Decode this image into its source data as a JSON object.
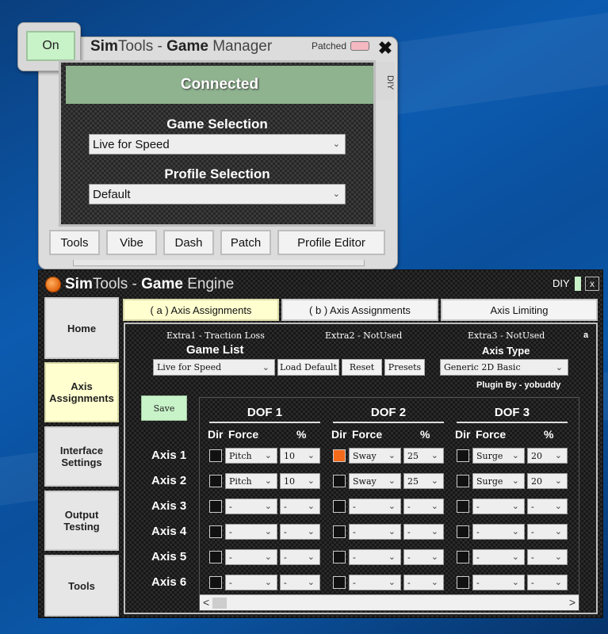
{
  "manager": {
    "on_label": "On",
    "title_sim": "Sim",
    "title_tools": "Tools - ",
    "title_game": "Game",
    "title_manager": " Manager",
    "patched_label": "Patched",
    "close_label": "✖",
    "diy_label": "DIY",
    "status": "Connected",
    "game_selection_label": "Game Selection",
    "game_selection_value": "Live for Speed",
    "profile_selection_label": "Profile Selection",
    "profile_selection_value": "Default",
    "buttons": [
      "Tools",
      "Vibe",
      "Dash",
      "Patch",
      "Profile Editor"
    ]
  },
  "engine": {
    "title_sim": "Sim",
    "title_tools": "Tools - ",
    "title_game": "Game",
    "title_engine": " Engine",
    "diy_label": "DIY",
    "close_label": "x",
    "sidebar": [
      "Home",
      "Axis Assignments",
      "Interface Settings",
      "Output Testing",
      "Tools"
    ],
    "tabs": [
      "( a ) Axis Assignments",
      "( b ) Axis Assignments",
      "Axis Limiting"
    ],
    "extras": [
      "Extra1 - Traction Loss",
      "Extra2 - NotUsed",
      "Extra3 - NotUsed"
    ],
    "extra_marker": "a",
    "game_list_label": "Game List",
    "game_list_value": "Live for Speed",
    "load_default": "Load Default",
    "reset": "Reset",
    "presets": "Presets",
    "axis_type_label": "Axis Type",
    "axis_type_value": "Generic 2D Basic",
    "plugin_by": "Plugin By - yobuddy",
    "save": "Save",
    "dof_headers": [
      "DOF 1",
      "DOF 2",
      "DOF 3"
    ],
    "col_dir": "Dir",
    "col_force": "Force",
    "col_pct": "%",
    "axes": [
      {
        "label": "Axis 1",
        "dof": [
          {
            "dir": false,
            "force": "Pitch",
            "pct": "10"
          },
          {
            "dir": true,
            "force": "Sway",
            "pct": "25"
          },
          {
            "dir": false,
            "force": "Surge",
            "pct": "20"
          }
        ]
      },
      {
        "label": "Axis 2",
        "dof": [
          {
            "dir": false,
            "force": "Pitch",
            "pct": "10"
          },
          {
            "dir": false,
            "force": "Sway",
            "pct": "25"
          },
          {
            "dir": false,
            "force": "Surge",
            "pct": "20"
          }
        ]
      },
      {
        "label": "Axis 3",
        "dof": [
          {
            "dir": false,
            "force": "-",
            "pct": "-"
          },
          {
            "dir": false,
            "force": "-",
            "pct": "-"
          },
          {
            "dir": false,
            "force": "-",
            "pct": "-"
          }
        ]
      },
      {
        "label": "Axis 4",
        "dof": [
          {
            "dir": false,
            "force": "-",
            "pct": "-"
          },
          {
            "dir": false,
            "force": "-",
            "pct": "-"
          },
          {
            "dir": false,
            "force": "-",
            "pct": "-"
          }
        ]
      },
      {
        "label": "Axis 5",
        "dof": [
          {
            "dir": false,
            "force": "-",
            "pct": "-"
          },
          {
            "dir": false,
            "force": "-",
            "pct": "-"
          },
          {
            "dir": false,
            "force": "-",
            "pct": "-"
          }
        ]
      },
      {
        "label": "Axis 6",
        "dof": [
          {
            "dir": false,
            "force": "-",
            "pct": "-"
          },
          {
            "dir": false,
            "force": "-",
            "pct": "-"
          },
          {
            "dir": false,
            "force": "-",
            "pct": "-"
          }
        ]
      }
    ],
    "scroll_left": "<",
    "scroll_right": ">"
  },
  "colors": {
    "on_green": "#c8f2c8",
    "connected_green": "#8fb28f",
    "active_yellow": "#ffffd0",
    "dir_active_orange": "#f36a1a",
    "patched_pink": "#f4b8c0"
  }
}
